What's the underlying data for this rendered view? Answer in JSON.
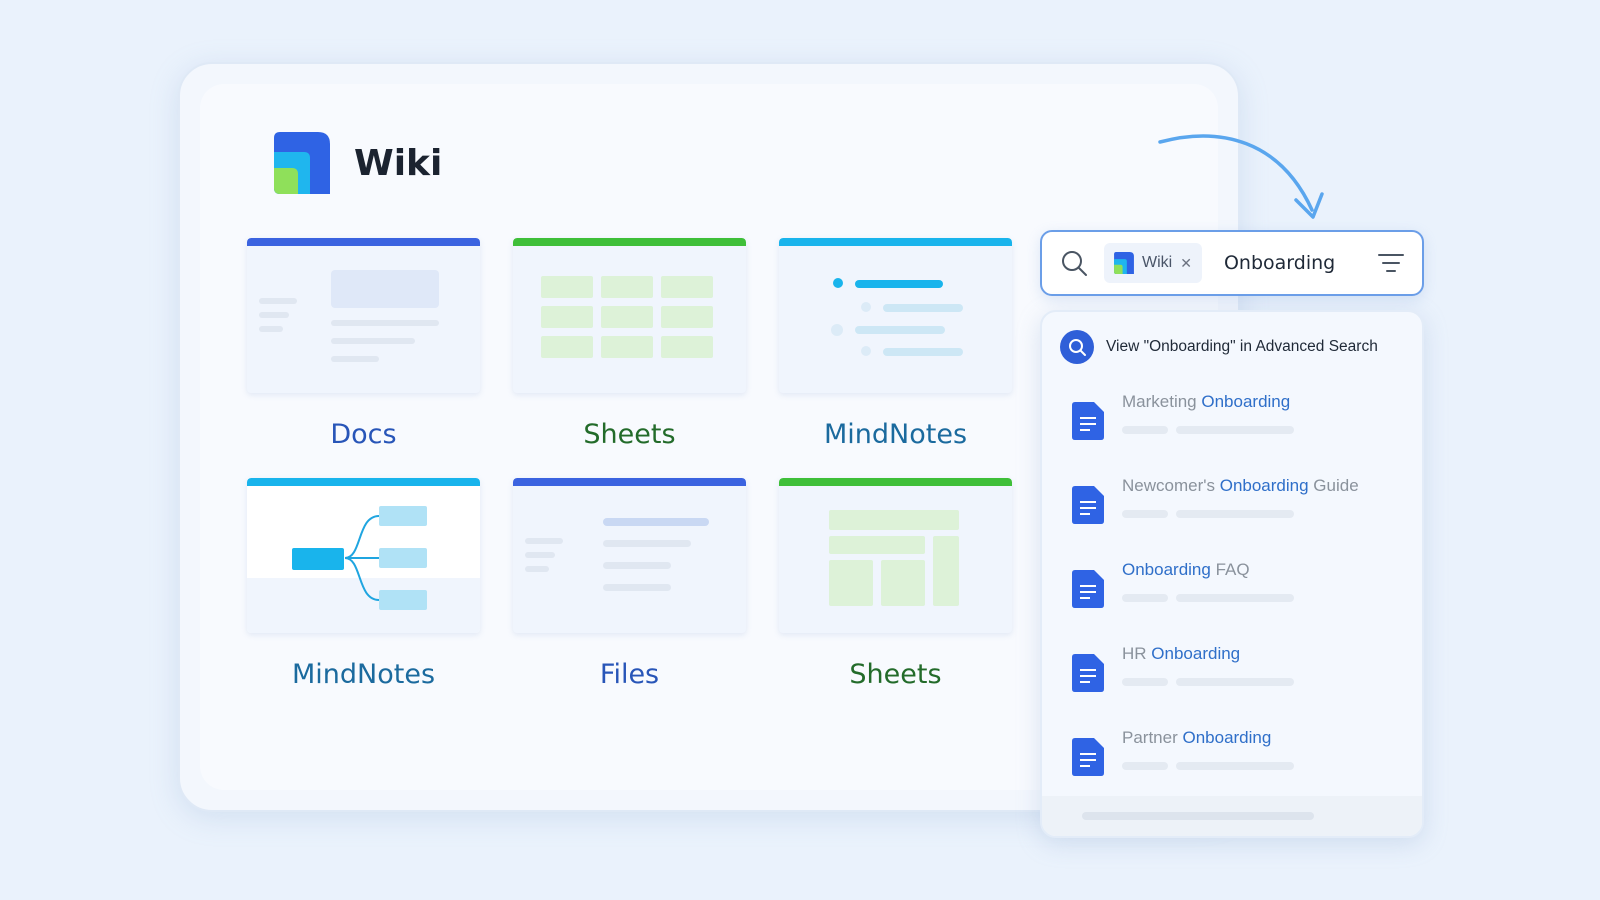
{
  "app": {
    "title": "Wiki",
    "colors": {
      "blue": "#3b63e0",
      "green": "#3fbf39",
      "cyan": "#19b4ec",
      "accent": "#2f5fd8"
    }
  },
  "cards": [
    {
      "label": "Docs",
      "type": "docs",
      "bar_color": "#3b63e0",
      "label_color": "#2855b8"
    },
    {
      "label": "Sheets",
      "type": "sheets",
      "bar_color": "#3fbf39",
      "label_color": "#236b2a"
    },
    {
      "label": "MindNotes",
      "type": "mindnotes-list",
      "bar_color": "#19b4ec",
      "label_color": "#1b6a9e"
    },
    {
      "label": "MindNotes",
      "type": "mindnotes-map",
      "bar_color": "#19b4ec",
      "label_color": "#1b6a9e"
    },
    {
      "label": "Files",
      "type": "files",
      "bar_color": "#3b63e0",
      "label_color": "#2855b8"
    },
    {
      "label": "Sheets",
      "type": "sheets-layout",
      "bar_color": "#3fbf39",
      "label_color": "#236b2a"
    }
  ],
  "search": {
    "scope_chip": "Wiki",
    "query": "Onboarding",
    "icons": {
      "search": "search-icon",
      "close": "close-icon",
      "filter": "filter-icon"
    }
  },
  "results": {
    "advanced_search_label": "View \"Onboarding\" in Advanced Search",
    "items": [
      {
        "before": "Marketing ",
        "highlight": "Onboarding",
        "after": ""
      },
      {
        "before": "Newcomer's ",
        "highlight": "Onboarding",
        "after": " Guide"
      },
      {
        "before": "",
        "highlight": "Onboarding",
        "after": " FAQ"
      },
      {
        "before": "HR ",
        "highlight": "Onboarding",
        "after": ""
      },
      {
        "before": "Partner ",
        "highlight": "Onboarding",
        "after": ""
      }
    ]
  }
}
